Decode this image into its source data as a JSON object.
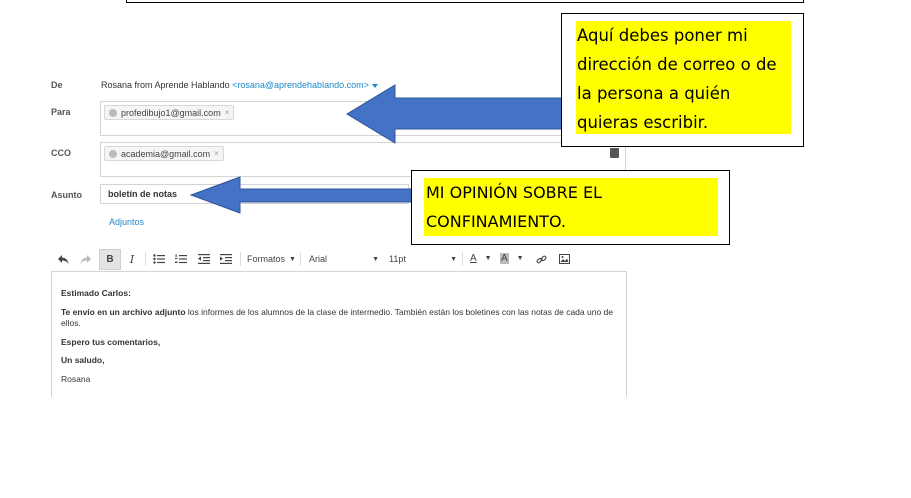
{
  "from": {
    "label": "De",
    "name": "Rosana from Aprende Hablando",
    "email": "<rosana@aprendehablando.com>"
  },
  "to": {
    "label": "Para",
    "chips": [
      "profedibujo1@gmail.com"
    ],
    "remove_glyph": "×"
  },
  "cco": {
    "label": "CCO",
    "chips": [
      "academia@gmail.com"
    ],
    "remove_glyph": "×"
  },
  "subject": {
    "label": "Asunto",
    "value": "boletín de notas"
  },
  "attachments_link": "Adjuntos",
  "toolbar": {
    "format_label": "Formatos",
    "font_name": "Arial",
    "font_size": "11pt",
    "bold": "B",
    "italic": "I",
    "text_color": "A",
    "bg_color": "A"
  },
  "body": {
    "greeting": "Estimado Carlos:",
    "line1_bold": "Te envío en un archivo adjunto",
    "line1_rest": " los informes de los alumnos de la clase de intermedio. También están los boletines con las notas de cada uno de ellos.",
    "line2": "Espero tus comentarios,",
    "line3": "Un saludo,",
    "signature": "Rosana"
  },
  "callout_1": {
    "text": "Aquí debes poner mi dirección de correo o de la persona a quién quieras escribir.",
    "highlight_color": "#ffff00"
  },
  "callout_2": {
    "text": "MI OPINIÓN SOBRE EL CONFINAMIENTO.",
    "highlight_color": "#ffff00"
  },
  "arrow_color": "#4472c4"
}
